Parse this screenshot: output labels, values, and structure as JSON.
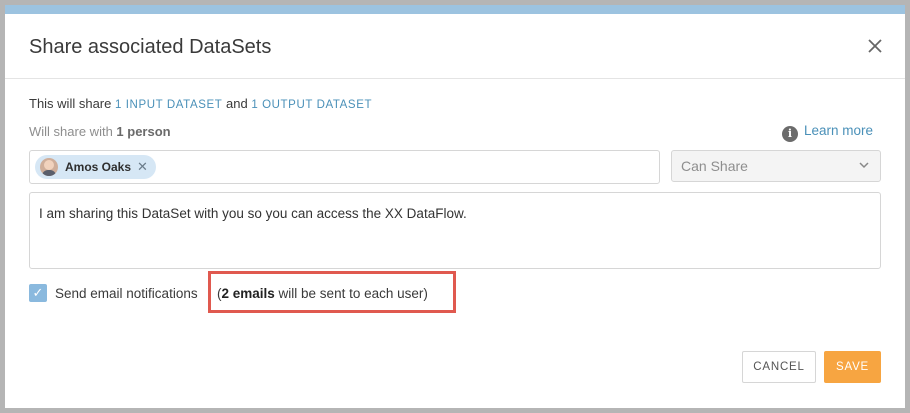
{
  "dialog": {
    "title": "Share associated DataSets",
    "close_icon": "close-icon"
  },
  "summary": {
    "prefix": "This will share ",
    "input_link": "1 INPUT DATASET",
    "middle": " and ",
    "output_link": "1 OUTPUT DATASET"
  },
  "share_with": {
    "prefix": "Will share with ",
    "count": "1 person"
  },
  "learn_more": {
    "icon": "info-icon",
    "label": "Learn more"
  },
  "recipients": [
    {
      "name": "Amos Oaks",
      "remove_icon": "remove-x-icon"
    }
  ],
  "permission": {
    "selected": "Can Share",
    "icon": "chevron-down-icon"
  },
  "message": {
    "value": "I am sharing this DataSet with you so you can access the XX DataFlow."
  },
  "notifications": {
    "checked": true,
    "label": "Send email notifications",
    "note_open": "(",
    "note_bold": "2 emails",
    "note_rest": " will be sent to each user)"
  },
  "buttons": {
    "cancel": "CANCEL",
    "save": "SAVE"
  },
  "colors": {
    "accent": "#4a90b8",
    "save": "#f7a541",
    "highlight": "#e0594f",
    "topbar": "#9cc3e0"
  }
}
